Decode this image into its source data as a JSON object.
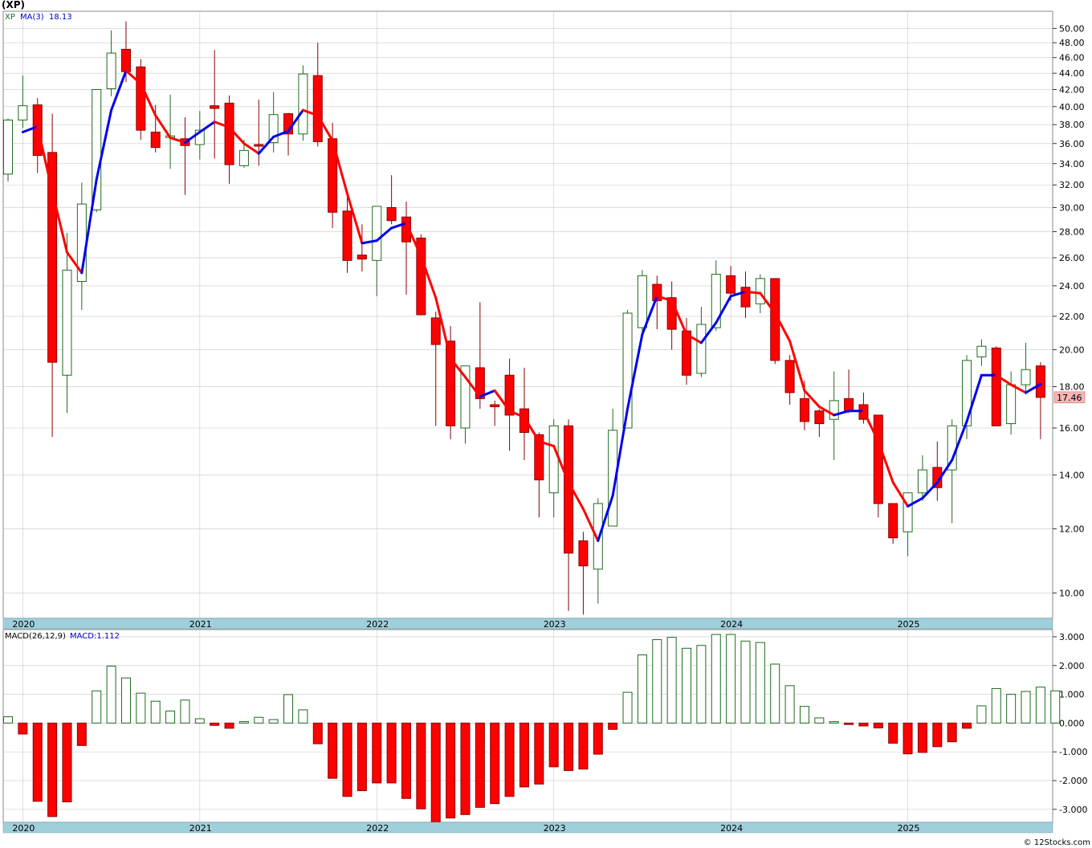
{
  "header": {
    "title": "(XP)",
    "legend_symbol": "XP",
    "legend_ma": "MA(3)",
    "legend_ma_value": "18.13",
    "macd_label": "MACD(26,12,9)",
    "macd_value_label": "MACD:1.112",
    "last_price_tag": "17.46",
    "credit": "© 12Stocks.com"
  },
  "colors": {
    "up": "#1e6b1e",
    "down": "#ff0000",
    "ma_up": "#0000ee",
    "ma_down": "#ff0000",
    "axis_band": "#9fcfdb",
    "grid": "#c8c8c8",
    "price_tag": "#f4b5b5"
  },
  "chart_data": [
    {
      "type": "candlestick",
      "scale": "log",
      "ylim": [
        9.3,
        52.5
      ],
      "yticks": [
        "10.00",
        "12.00",
        "14.00",
        "16.00",
        "18.00",
        "20.00",
        "22.00",
        "24.00",
        "26.00",
        "28.00",
        "30.00",
        "32.00",
        "34.00",
        "36.00",
        "38.00",
        "40.00",
        "42.00",
        "44.00",
        "46.00",
        "48.00",
        "50.00"
      ],
      "year_labels": [
        "2020",
        "2021",
        "2022",
        "2023",
        "2024",
        "2025"
      ],
      "month_start": "2020-01",
      "candles": [
        [
          33.0,
          38.7,
          32.3,
          38.5
        ],
        [
          38.5,
          43.7,
          37.6,
          40.1
        ],
        [
          40.2,
          41.0,
          33.1,
          34.8
        ],
        [
          35.1,
          39.2,
          15.6,
          19.3
        ],
        [
          18.6,
          27.9,
          16.7,
          25.1
        ],
        [
          24.3,
          32.2,
          22.4,
          30.3
        ],
        [
          29.8,
          39.5,
          29.6,
          42.0
        ],
        [
          42.1,
          49.7,
          41.2,
          46.6
        ],
        [
          47.1,
          51.0,
          42.9,
          44.2
        ],
        [
          44.8,
          45.8,
          36.4,
          37.4
        ],
        [
          37.2,
          40.2,
          35.1,
          35.6
        ],
        [
          36.8,
          41.4,
          33.5,
          36.8
        ],
        [
          36.5,
          38.8,
          31.1,
          35.8
        ],
        [
          35.9,
          39.5,
          34.4,
          37.4
        ],
        [
          40.1,
          47.0,
          34.5,
          39.8
        ],
        [
          40.4,
          41.3,
          32.1,
          33.9
        ],
        [
          33.8,
          36.4,
          33.6,
          35.3
        ],
        [
          35.9,
          40.8,
          33.8,
          35.8
        ],
        [
          36.1,
          41.7,
          35.1,
          39.1
        ],
        [
          39.2,
          39.3,
          34.8,
          37.0
        ],
        [
          37.0,
          45.0,
          36.3,
          43.9
        ],
        [
          43.7,
          48.0,
          35.7,
          36.2
        ],
        [
          36.5,
          38.2,
          28.3,
          29.6
        ],
        [
          29.7,
          31.1,
          24.9,
          25.8
        ],
        [
          26.2,
          28.6,
          25.0,
          25.9
        ],
        [
          25.8,
          30.1,
          23.3,
          30.1
        ],
        [
          30.0,
          32.9,
          28.6,
          28.9
        ],
        [
          29.2,
          30.5,
          23.4,
          27.2
        ],
        [
          27.5,
          27.8,
          22.2,
          22.1
        ],
        [
          21.9,
          22.3,
          16.1,
          20.3
        ],
        [
          20.5,
          21.4,
          15.5,
          16.1
        ],
        [
          16.0,
          19.0,
          15.3,
          19.1
        ],
        [
          19.0,
          22.9,
          16.9,
          17.4
        ],
        [
          17.1,
          17.3,
          16.1,
          17.0
        ],
        [
          18.6,
          19.5,
          15.0,
          16.6
        ],
        [
          16.9,
          19.0,
          14.6,
          15.8
        ],
        [
          15.7,
          15.8,
          12.4,
          13.8
        ],
        [
          13.3,
          16.4,
          12.4,
          16.1
        ],
        [
          16.1,
          16.4,
          9.5,
          11.2
        ],
        [
          11.6,
          11.9,
          9.4,
          10.8
        ],
        [
          10.7,
          13.1,
          9.7,
          12.9
        ],
        [
          12.1,
          16.9,
          12.1,
          15.9
        ],
        [
          16.0,
          22.4,
          16.1,
          22.2
        ],
        [
          21.3,
          25.1,
          20.7,
          24.7
        ],
        [
          24.1,
          24.7,
          21.2,
          23.0
        ],
        [
          23.2,
          24.3,
          20.0,
          21.2
        ],
        [
          21.1,
          21.9,
          18.1,
          18.6
        ],
        [
          18.7,
          22.6,
          18.5,
          21.5
        ],
        [
          21.3,
          25.8,
          21.1,
          24.8
        ],
        [
          24.7,
          25.4,
          23.0,
          23.5
        ],
        [
          23.9,
          25.0,
          21.9,
          22.6
        ],
        [
          22.8,
          24.8,
          22.2,
          24.5
        ],
        [
          24.5,
          24.5,
          19.2,
          19.4
        ],
        [
          19.4,
          19.7,
          17.1,
          17.7
        ],
        [
          17.4,
          18.3,
          15.9,
          16.3
        ],
        [
          16.8,
          16.9,
          15.6,
          16.2
        ],
        [
          16.4,
          18.8,
          14.6,
          17.3
        ],
        [
          17.4,
          18.9,
          16.7,
          16.8
        ],
        [
          17.1,
          17.7,
          16.2,
          16.4
        ],
        [
          16.6,
          16.6,
          12.4,
          12.9
        ],
        [
          12.9,
          12.9,
          11.5,
          11.7
        ],
        [
          11.9,
          13.1,
          11.1,
          13.3
        ],
        [
          13.3,
          14.8,
          13.0,
          14.2
        ],
        [
          14.3,
          15.4,
          13.0,
          13.5
        ],
        [
          14.2,
          16.4,
          12.2,
          16.1
        ],
        [
          16.1,
          19.7,
          15.5,
          19.4
        ],
        [
          19.6,
          20.6,
          19.1,
          20.2
        ],
        [
          20.1,
          20.2,
          16.1,
          16.1
        ],
        [
          16.2,
          18.8,
          15.7,
          18.1
        ],
        [
          18.1,
          20.4,
          17.6,
          18.9
        ],
        [
          19.1,
          19.3,
          15.5,
          17.46
        ]
      ],
      "ma": [
        null,
        37.2,
        37.8,
        31.4,
        26.4,
        24.9,
        32.5,
        39.6,
        44.3,
        42.7,
        39.0,
        36.6,
        36.1,
        37.2,
        38.3,
        37.7,
        36.0,
        35.0,
        36.7,
        37.3,
        39.6,
        39.0,
        36.3,
        31.2,
        27.1,
        27.3,
        28.3,
        28.7,
        26.1,
        23.2,
        19.5,
        18.5,
        17.5,
        17.8,
        16.8,
        16.5,
        15.4,
        15.2,
        13.7,
        12.7,
        11.6,
        13.2,
        16.9,
        20.9,
        23.3,
        23.0,
        20.9,
        20.4,
        21.6,
        23.3,
        23.6,
        23.5,
        22.2,
        20.5,
        17.8,
        17.0,
        16.6,
        16.8,
        16.8,
        15.4,
        13.7,
        12.8,
        13.1,
        13.7,
        14.6,
        16.3,
        18.6,
        18.6,
        18.1,
        17.7,
        18.13
      ],
      "macd_ylim": [
        -3.45,
        3.25
      ],
      "macd_yticks": [
        "3.000",
        "2.000",
        "1.000",
        "0.000",
        "-1.000",
        "-2.000",
        "-3.000"
      ],
      "macd_hist": [
        0.22,
        -0.38,
        -2.72,
        -3.25,
        -2.74,
        -0.78,
        1.12,
        1.98,
        1.57,
        1.04,
        0.76,
        0.42,
        0.8,
        0.15,
        -0.08,
        -0.18,
        0.05,
        0.2,
        0.12,
        0.99,
        0.46,
        -0.72,
        -1.92,
        -2.55,
        -2.35,
        -2.08,
        -2.08,
        -2.62,
        -2.98,
        -3.45,
        -3.3,
        -3.18,
        -2.93,
        -2.8,
        -2.55,
        -2.22,
        -2.12,
        -1.52,
        -1.65,
        -1.6,
        -1.08,
        -0.22,
        1.07,
        2.37,
        2.9,
        2.98,
        2.6,
        2.7,
        3.08,
        3.08,
        2.85,
        2.8,
        2.05,
        1.3,
        0.58,
        0.18,
        0.05,
        -0.05,
        -0.1,
        -0.17,
        -0.7,
        -1.07,
        -1.02,
        -0.82,
        -0.65,
        -0.18,
        0.6,
        1.2,
        1.0,
        1.1,
        1.25,
        1.12
      ]
    }
  ]
}
